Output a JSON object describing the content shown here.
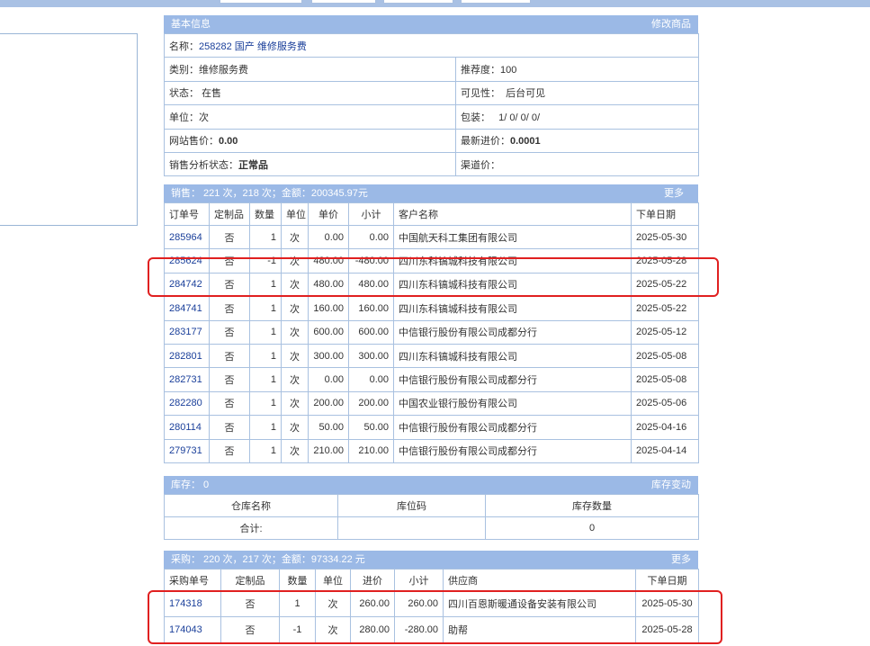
{
  "basic": {
    "title": "基本信息",
    "edit_link": "修改商品",
    "name_label": "名称：",
    "name_value": "258282 国产 维修服务费",
    "category_label": "类别：",
    "category_value": "维修服务费",
    "recommend_label": "推荐度：",
    "recommend_value": "100",
    "status_label": "状态：",
    "status_value": "在售",
    "visibility_label": "可见性：",
    "visibility_value": "后台可见",
    "unit_label": "单位：",
    "unit_value": "次",
    "package_label": "包装：",
    "package_value": "1/ 0/ 0/ 0/",
    "web_price_label": "网站售价：",
    "web_price_value": "0.00",
    "latest_cost_label": "最新进价：",
    "latest_cost_value": "0.0001",
    "analysis_label": "销售分析状态：",
    "analysis_value": "正常品",
    "channel_label": "渠道价："
  },
  "sales": {
    "summary": "销售：  221 次，218 次；金额：200345.97元",
    "more": "更多",
    "headers": [
      "订单号",
      "定制品",
      "数量",
      "单位",
      "单价",
      "小计",
      "客户名称",
      "下单日期"
    ],
    "rows": [
      {
        "id": "285964",
        "custom": "否",
        "qty": "1",
        "unit": "次",
        "price": "0.00",
        "subtotal": "0.00",
        "customer": "中国航天科工集团有限公司",
        "date": "2025-05-30"
      },
      {
        "id": "285624",
        "custom": "否",
        "qty": "-1",
        "unit": "次",
        "price": "480.00",
        "subtotal": "-480.00",
        "customer": "四川东科镐城科技有限公司",
        "date": "2025-05-28"
      },
      {
        "id": "284742",
        "custom": "否",
        "qty": "1",
        "unit": "次",
        "price": "480.00",
        "subtotal": "480.00",
        "customer": "四川东科镐城科技有限公司",
        "date": "2025-05-22"
      },
      {
        "id": "284741",
        "custom": "否",
        "qty": "1",
        "unit": "次",
        "price": "160.00",
        "subtotal": "160.00",
        "customer": "四川东科镐城科技有限公司",
        "date": "2025-05-22"
      },
      {
        "id": "283177",
        "custom": "否",
        "qty": "1",
        "unit": "次",
        "price": "600.00",
        "subtotal": "600.00",
        "customer": "中信银行股份有限公司成都分行",
        "date": "2025-05-12"
      },
      {
        "id": "282801",
        "custom": "否",
        "qty": "1",
        "unit": "次",
        "price": "300.00",
        "subtotal": "300.00",
        "customer": "四川东科镐城科技有限公司",
        "date": "2025-05-08"
      },
      {
        "id": "282731",
        "custom": "否",
        "qty": "1",
        "unit": "次",
        "price": "0.00",
        "subtotal": "0.00",
        "customer": "中信银行股份有限公司成都分行",
        "date": "2025-05-08"
      },
      {
        "id": "282280",
        "custom": "否",
        "qty": "1",
        "unit": "次",
        "price": "200.00",
        "subtotal": "200.00",
        "customer": "中国农业银行股份有限公司",
        "date": "2025-05-06"
      },
      {
        "id": "280114",
        "custom": "否",
        "qty": "1",
        "unit": "次",
        "price": "50.00",
        "subtotal": "50.00",
        "customer": "中信银行股份有限公司成都分行",
        "date": "2025-04-16"
      },
      {
        "id": "279731",
        "custom": "否",
        "qty": "1",
        "unit": "次",
        "price": "210.00",
        "subtotal": "210.00",
        "customer": "中信银行股份有限公司成都分行",
        "date": "2025-04-14"
      }
    ]
  },
  "stock": {
    "summary": "库存：  0",
    "change_link": "库存变动",
    "headers": [
      "仓库名称",
      "库位码",
      "库存数量"
    ],
    "total_label": "合计:",
    "total_value": "0"
  },
  "purchase": {
    "summary": "采购：  220 次，217 次；金额：97334.22 元",
    "more": "更多",
    "headers": [
      "采购单号",
      "定制品",
      "数量",
      "单位",
      "进价",
      "小计",
      "供应商",
      "下单日期"
    ],
    "rows": [
      {
        "id": "174318",
        "custom": "否",
        "qty": "1",
        "unit": "次",
        "price": "260.00",
        "subtotal": "260.00",
        "supplier": "四川百恩斯暖通设备安装有限公司",
        "date": "2025-05-30"
      },
      {
        "id": "174043",
        "custom": "否",
        "qty": "-1",
        "unit": "次",
        "price": "280.00",
        "subtotal": "-280.00",
        "supplier": "助帮",
        "date": "2025-05-28"
      }
    ]
  },
  "colors": {
    "header_bg": "#9bb9e6",
    "border": "#a9c1e0",
    "link": "#1a3f9a",
    "highlight": "#e02020"
  }
}
